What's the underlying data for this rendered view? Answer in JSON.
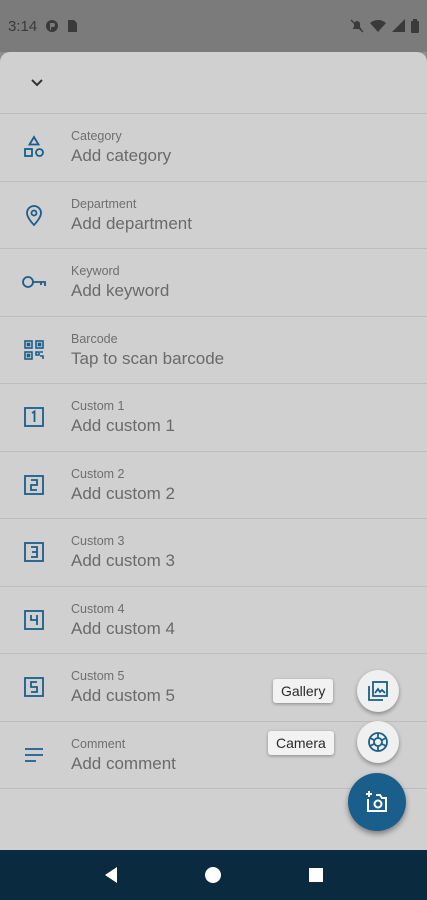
{
  "status_bar": {
    "time": "3:14",
    "icons": [
      "notification-icon",
      "sim-icon",
      "mute-icon",
      "wifi-icon",
      "signal-icon",
      "battery-icon"
    ]
  },
  "sheet": {
    "collapse_icon": "chevron-down-icon",
    "rows": [
      {
        "label": "Category",
        "value": "Add category",
        "icon": "shapes-icon"
      },
      {
        "label": "Department",
        "value": "Add department",
        "icon": "location-pin-icon"
      },
      {
        "label": "Keyword",
        "value": "Add keyword",
        "icon": "key-icon"
      },
      {
        "label": "Barcode",
        "value": "Tap to scan barcode",
        "icon": "qr-code-icon"
      },
      {
        "label": "Custom 1",
        "value": "Add custom 1",
        "icon": "number-1-icon"
      },
      {
        "label": "Custom 2",
        "value": "Add custom 2",
        "icon": "number-2-icon"
      },
      {
        "label": "Custom 3",
        "value": "Add custom 3",
        "icon": "number-3-icon"
      },
      {
        "label": "Custom 4",
        "value": "Add custom 4",
        "icon": "number-4-icon"
      },
      {
        "label": "Custom 5",
        "value": "Add custom 5",
        "icon": "number-5-icon"
      },
      {
        "label": "Comment",
        "value": "Add comment",
        "icon": "notes-icon"
      }
    ]
  },
  "fab": {
    "gallery_label": "Gallery",
    "camera_label": "Camera",
    "accent_color": "#1a5e8c"
  },
  "colors": {
    "icon": "#1a5e8c",
    "nav_bar": "#0a2a40"
  }
}
